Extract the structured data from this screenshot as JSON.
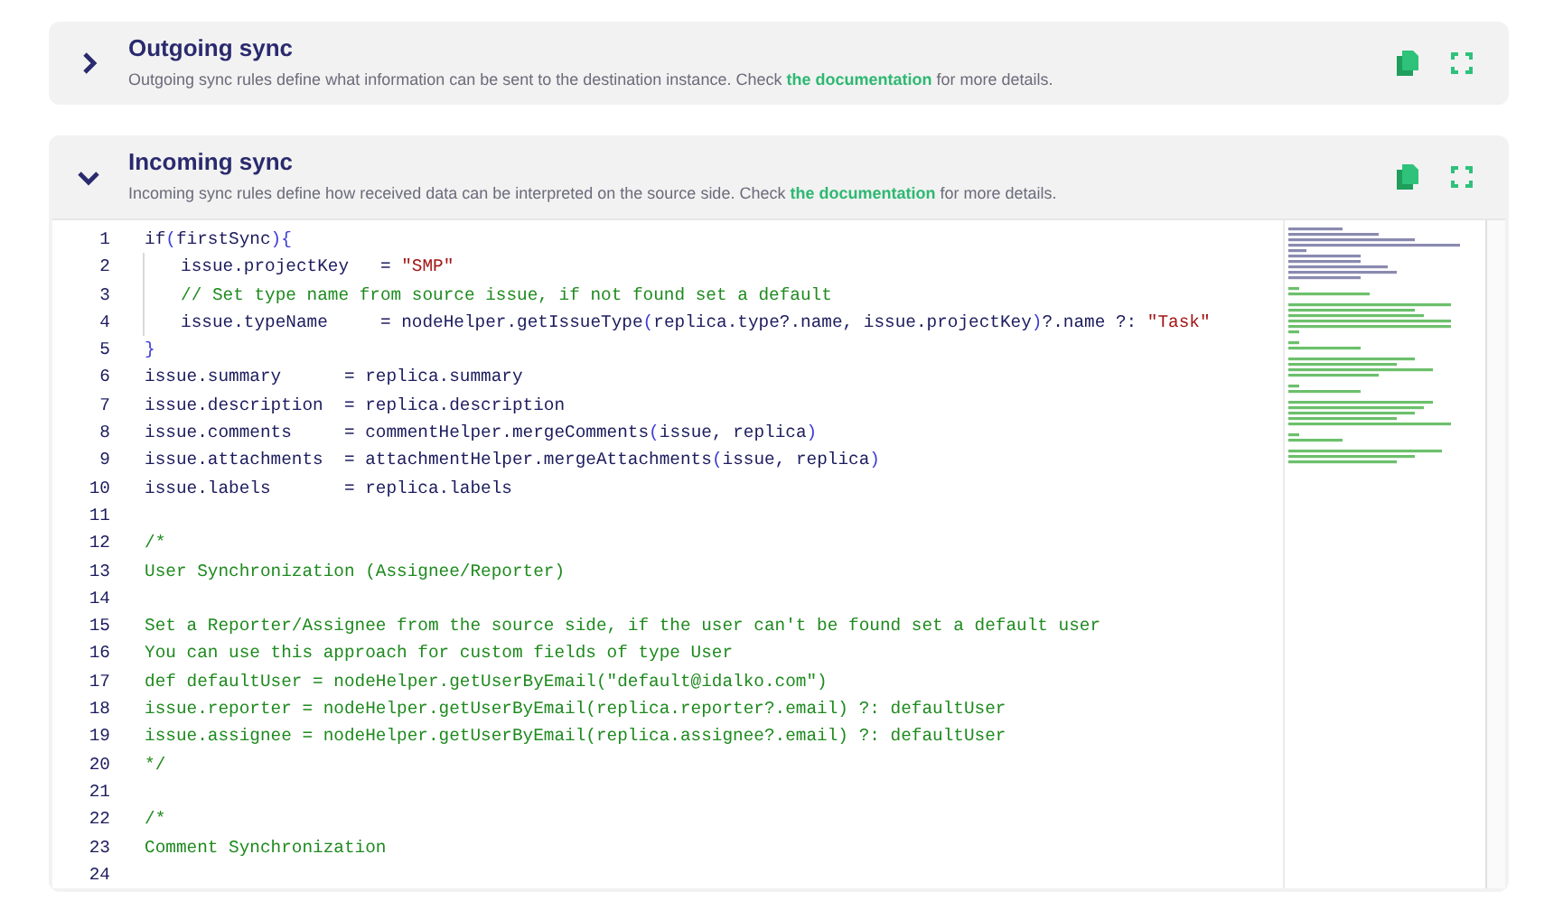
{
  "sections": [
    {
      "title": "Outgoing sync",
      "expanded": false,
      "description": {
        "before": "Outgoing sync rules define what information can be sent to the destination instance. Check ",
        "link": "the documentation",
        "after": " for more details."
      }
    },
    {
      "title": "Incoming sync",
      "expanded": true,
      "description": {
        "before": "Incoming sync rules define how received data can be interpreted on the source side. Check ",
        "link": "the documentation",
        "after": " for more details."
      },
      "code": [
        {
          "number": "1",
          "indent": false,
          "tokens": [
            {
              "text": "if",
              "kind": "code"
            },
            {
              "text": "(",
              "kind": "bracket"
            },
            {
              "text": "firstSync",
              "kind": "code"
            },
            {
              "text": "){",
              "kind": "bracket"
            }
          ]
        },
        {
          "number": "2",
          "indent": true,
          "tokens": [
            {
              "text": "issue.projectKey   = ",
              "kind": "code"
            },
            {
              "text": "\"SMP\"",
              "kind": "string"
            }
          ]
        },
        {
          "number": "3",
          "indent": true,
          "tokens": [
            {
              "text": "// Set type name from source issue, if not found set a default",
              "kind": "comment"
            }
          ]
        },
        {
          "number": "4",
          "indent": true,
          "tokens": [
            {
              "text": "issue.typeName     = nodeHelper.getIssueType",
              "kind": "code"
            },
            {
              "text": "(",
              "kind": "bracket"
            },
            {
              "text": "replica.type?.name, issue.projectKey",
              "kind": "code"
            },
            {
              "text": ")",
              "kind": "bracket"
            },
            {
              "text": "?.name ?: ",
              "kind": "code"
            },
            {
              "text": "\"Task\"",
              "kind": "string"
            }
          ]
        },
        {
          "number": "5",
          "indent": false,
          "tokens": [
            {
              "text": "}",
              "kind": "bracket"
            }
          ]
        },
        {
          "number": "6",
          "indent": false,
          "tokens": [
            {
              "text": "issue.summary      = replica.summary",
              "kind": "code"
            }
          ]
        },
        {
          "number": "7",
          "indent": false,
          "tokens": [
            {
              "text": "issue.description  = replica.description",
              "kind": "code"
            }
          ]
        },
        {
          "number": "8",
          "indent": false,
          "tokens": [
            {
              "text": "issue.comments     = commentHelper.mergeComments",
              "kind": "code"
            },
            {
              "text": "(",
              "kind": "bracket"
            },
            {
              "text": "issue, replica",
              "kind": "code"
            },
            {
              "text": ")",
              "kind": "bracket"
            }
          ]
        },
        {
          "number": "9",
          "indent": false,
          "tokens": [
            {
              "text": "issue.attachments  = attachmentHelper.mergeAttachments",
              "kind": "code"
            },
            {
              "text": "(",
              "kind": "bracket"
            },
            {
              "text": "issue, replica",
              "kind": "code"
            },
            {
              "text": ")",
              "kind": "bracket"
            }
          ]
        },
        {
          "number": "10",
          "indent": false,
          "tokens": [
            {
              "text": "issue.labels       = replica.labels",
              "kind": "code"
            }
          ]
        },
        {
          "number": "11",
          "indent": false
        },
        {
          "number": "12",
          "indent": false,
          "tokens": [
            {
              "text": "/*",
              "kind": "comment"
            }
          ]
        },
        {
          "number": "13",
          "indent": false,
          "tokens": [
            {
              "text": "User Synchronization (Assignee/Reporter)",
              "kind": "comment"
            }
          ]
        },
        {
          "number": "14",
          "indent": false
        },
        {
          "number": "15",
          "indent": false,
          "tokens": [
            {
              "text": "Set a Reporter/Assignee from the source side, if the user can't be found set a default user",
              "kind": "comment"
            }
          ]
        },
        {
          "number": "16",
          "indent": false,
          "tokens": [
            {
              "text": "You can use this approach for custom fields of type User",
              "kind": "comment"
            }
          ]
        },
        {
          "number": "17",
          "indent": false,
          "tokens": [
            {
              "text": "def defaultUser = nodeHelper.getUserByEmail(\"default@idalko.com\")",
              "kind": "comment"
            }
          ]
        },
        {
          "number": "18",
          "indent": false,
          "tokens": [
            {
              "text": "issue.reporter = nodeHelper.getUserByEmail(replica.reporter?.email) ?: defaultUser",
              "kind": "comment"
            }
          ]
        },
        {
          "number": "19",
          "indent": false,
          "tokens": [
            {
              "text": "issue.assignee = nodeHelper.getUserByEmail(replica.assignee?.email) ?: defaultUser",
              "kind": "comment"
            }
          ]
        },
        {
          "number": "20",
          "indent": false,
          "tokens": [
            {
              "text": "*/",
              "kind": "comment"
            }
          ]
        },
        {
          "number": "21",
          "indent": false
        },
        {
          "number": "22",
          "indent": false,
          "tokens": [
            {
              "text": "/*",
              "kind": "comment"
            }
          ]
        },
        {
          "number": "23",
          "indent": false,
          "tokens": [
            {
              "text": "Comment Synchronization",
              "kind": "comment"
            }
          ]
        },
        {
          "number": "24",
          "indent": false
        }
      ]
    }
  ]
}
